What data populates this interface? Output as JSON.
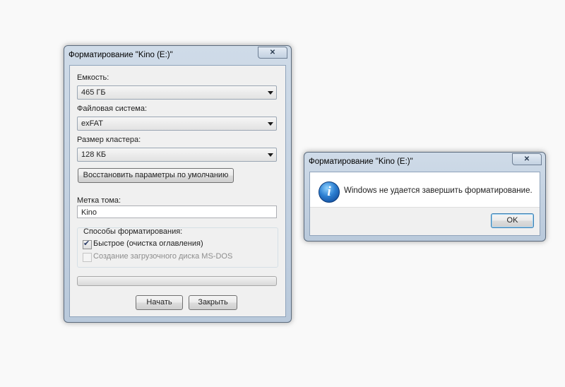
{
  "format_dialog": {
    "title": "Форматирование \"Kino (E:)\"",
    "close_glyph": "✕",
    "capacity_label": "Емкость:",
    "capacity_value": "465 ГБ",
    "filesystem_label": "Файловая система:",
    "filesystem_value": "exFAT",
    "cluster_label": "Размер кластера:",
    "cluster_value": "128 КБ",
    "restore_defaults_label": "Восстановить параметры по умолчанию",
    "volume_label_label": "Метка тома:",
    "volume_label_value": "Kino",
    "format_options_label": "Способы форматирования:",
    "quick_format_label": "Быстрое (очистка оглавления)",
    "quick_format_checked": true,
    "msdos_label": "Создание загрузочного диска MS-DOS",
    "msdos_checked": false,
    "msdos_enabled": false,
    "progress": 0,
    "start_label": "Начать",
    "close_label": "Закрыть"
  },
  "message_box": {
    "title": "Форматирование \"Kino (E:)\"",
    "close_glyph": "✕",
    "icon": "info-icon",
    "icon_glyph": "i",
    "message": "Windows не удается завершить форматирование.",
    "ok_label": "OK"
  }
}
